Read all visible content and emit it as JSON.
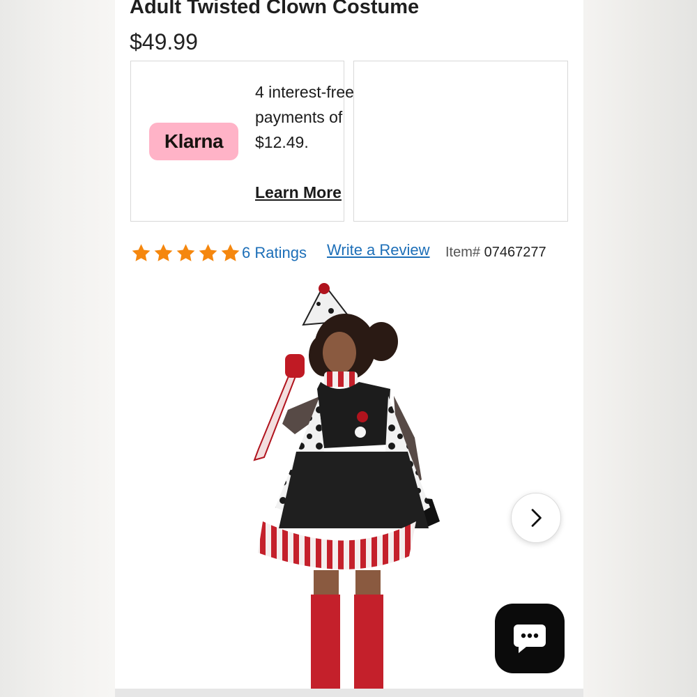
{
  "product": {
    "title": "Adult Twisted Clown Costume",
    "price": "$49.99",
    "item_label": "Item#",
    "item_number": "07467277"
  },
  "klarna": {
    "logo_text": "Klarna",
    "message": "4 interest-free payments of $12.49.",
    "link_text": "Learn More"
  },
  "rating": {
    "stars": 5,
    "max_stars": 5,
    "count_text": "6 Ratings",
    "write_review_text": "Write a Review"
  },
  "gallery": {
    "next_icon": "chevron-right-icon"
  },
  "chat": {
    "icon": "chat-bubble-icon"
  },
  "colors": {
    "link": "#1d6fb8",
    "star": "#f5870e",
    "klarna_pink": "#ffb3c7",
    "chat_button": "#0b0b0b"
  }
}
